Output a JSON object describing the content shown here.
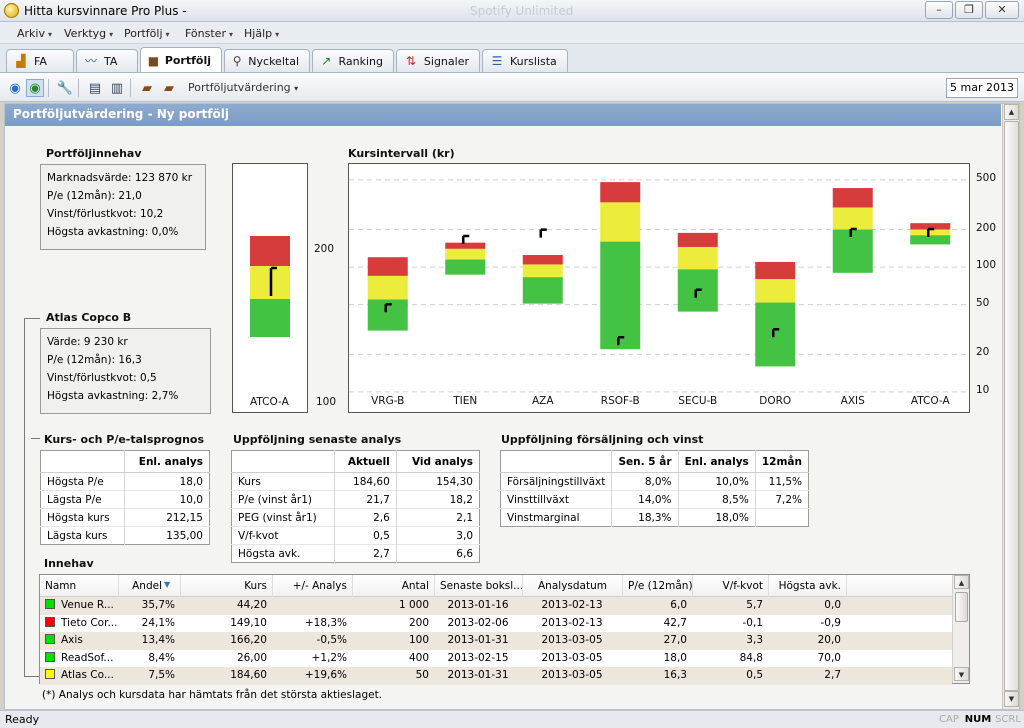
{
  "window": {
    "title": "Hitta kursvinnare Pro Plus -",
    "ghost_title": "Spotify Unlimited",
    "controls": {
      "minimize": "–",
      "restore": "❐",
      "close": "✕"
    }
  },
  "menu": [
    "Arkiv",
    "Verktyg",
    "Portfölj",
    "Fönster",
    "Hjälp"
  ],
  "tabs": [
    {
      "label": "FA",
      "icon": "bar-chart-icon"
    },
    {
      "label": "TA",
      "icon": "line-chart-icon"
    },
    {
      "label": "Portfölj",
      "icon": "briefcase-icon",
      "active": true
    },
    {
      "label": "Nyckeltal",
      "icon": "magnifier-icon"
    },
    {
      "label": "Ranking",
      "icon": "trend-icon"
    },
    {
      "label": "Signaler",
      "icon": "signal-arrows-icon"
    },
    {
      "label": "Kurslista",
      "icon": "list-icon"
    }
  ],
  "toolbar": {
    "dropdown_label": "Portföljutvärdering",
    "date": "5 mar 2013"
  },
  "page": {
    "header": "Portföljutvärdering - Ny portfölj"
  },
  "portfolio": {
    "title": "Portföljinnehav",
    "lines": [
      "Marknadsvärde: 123 870 kr",
      "P/e (12mån): 21,0",
      "Vinst/förlustkvot: 10,2",
      "Högsta avkastning: 0,0%"
    ]
  },
  "stock": {
    "title": "Atlas Copco B",
    "lines": [
      "Värde: 9 230 kr",
      "P/e (12mån): 16,3",
      "Vinst/förlustkvot: 0,5",
      "Högsta avkastning: 2,7%"
    ]
  },
  "atco_chart": {
    "label": "ATCO-A",
    "tick_high": "200",
    "tick_low": "100"
  },
  "chart_data": {
    "type": "bar",
    "title": "Kursintervall (kr)",
    "categories": [
      "VRG-B",
      "TIEN",
      "AZA",
      "RSOF-B",
      "SECU-B",
      "DORO",
      "AXIS",
      "ATCO-A"
    ],
    "y_scale": "log",
    "ylim": [
      8,
      600
    ],
    "y_ticks": [
      "500",
      "200",
      "100",
      "50",
      "20",
      "10"
    ],
    "gridlines": [
      500,
      200,
      100,
      50,
      20,
      10
    ],
    "colors": {
      "low": "#44c244",
      "mid": "#ecec3c",
      "high": "#d63c3c"
    },
    "ranges": [
      {
        "low": 31,
        "mid": 55,
        "high": 85,
        "top": 120,
        "price": 46
      },
      {
        "low": 87,
        "mid": 115,
        "high": 140,
        "top": 157,
        "price": 162
      },
      {
        "low": 51,
        "mid": 83,
        "high": 105,
        "top": 125,
        "price": 182
      },
      {
        "low": 22,
        "mid": 160,
        "high": 330,
        "top": 480,
        "price": 25
      },
      {
        "low": 44,
        "mid": 96,
        "high": 145,
        "top": 188,
        "price": 60
      },
      {
        "low": 16,
        "mid": 52,
        "high": 80,
        "top": 110,
        "price": 29
      },
      {
        "low": 90,
        "mid": 200,
        "high": 300,
        "top": 430,
        "price": 184
      },
      {
        "low": 152,
        "mid": 180,
        "high": 200,
        "top": 225,
        "price": 184
      }
    ]
  },
  "forecast": {
    "title": "Kurs- och P/e-talsprognos",
    "headers": [
      "",
      "Enl. analys"
    ],
    "rows": [
      [
        "Högsta P/e",
        "18,0"
      ],
      [
        "Lägsta P/e",
        "10,0"
      ],
      [
        "Högsta kurs",
        "212,15"
      ],
      [
        "Lägsta kurs",
        "135,00"
      ]
    ]
  },
  "analysis": {
    "title": "Uppföljning senaste analys",
    "headers": [
      "",
      "Aktuell",
      "Vid analys"
    ],
    "rows": [
      [
        "Kurs",
        "184,60",
        "154,30"
      ],
      [
        "P/e (vinst år1)",
        "21,7",
        "18,2"
      ],
      [
        "PEG (vinst år1)",
        "2,6",
        "2,1"
      ],
      [
        "V/f-kvot",
        "0,5",
        "3,0"
      ],
      [
        "Högsta avk.",
        "2,7",
        "6,6"
      ]
    ]
  },
  "sales": {
    "title": "Uppföljning försäljning och vinst",
    "headers": [
      "",
      "Sen. 5 år",
      "Enl. analys",
      "12mån"
    ],
    "rows": [
      [
        "Försäljningstillväxt",
        "8,0%",
        "10,0%",
        "11,5%"
      ],
      [
        "Vinsttillväxt",
        "14,0%",
        "8,5%",
        "7,2%"
      ],
      [
        "Vinstmarginal",
        "18,3%",
        "18,0%",
        ""
      ]
    ]
  },
  "holdings": {
    "title": "Innehav",
    "columns": [
      "Namn",
      "Andel",
      "Kurs",
      "+/- Analys",
      "Antal",
      "Senaste boksl...",
      "Analysdatum",
      "P/e (12mån)",
      "V/f-kvot",
      "Högsta avk."
    ],
    "rows": [
      {
        "color": "#00e000",
        "cells": [
          "Venue R...",
          "35,7%",
          "44,20",
          "",
          "1 000",
          "2013-01-16",
          "2013-02-13",
          "6,0",
          "5,7",
          "0,0"
        ]
      },
      {
        "color": "#ff0000",
        "cells": [
          "Tieto Cor...",
          "24,1%",
          "149,10",
          "+18,3%",
          "200",
          "2013-02-06",
          "2013-02-13",
          "42,7",
          "-0,1",
          "-0,9"
        ]
      },
      {
        "color": "#00e000",
        "cells": [
          "Axis",
          "13,4%",
          "166,20",
          "-0,5%",
          "100",
          "2013-01-31",
          "2013-03-05",
          "27,0",
          "3,3",
          "20,0"
        ]
      },
      {
        "color": "#00e000",
        "cells": [
          "ReadSof...",
          "8,4%",
          "26,00",
          "+1,2%",
          "400",
          "2013-02-15",
          "2013-03-05",
          "18,0",
          "84,8",
          "70,0"
        ]
      },
      {
        "color": "#ffff00",
        "cells": [
          "Atlas Co...",
          "7,5%",
          "184,60",
          "+19,6%",
          "50",
          "2013-01-31",
          "2013-03-05",
          "16,3",
          "0,5",
          "2,7"
        ]
      }
    ]
  },
  "footnote": "(*) Analys och kursdata har hämtats från det största aktieslaget.",
  "status": {
    "text": "Ready",
    "indicators": [
      "CAP",
      "NUM",
      "SCRL"
    ]
  }
}
